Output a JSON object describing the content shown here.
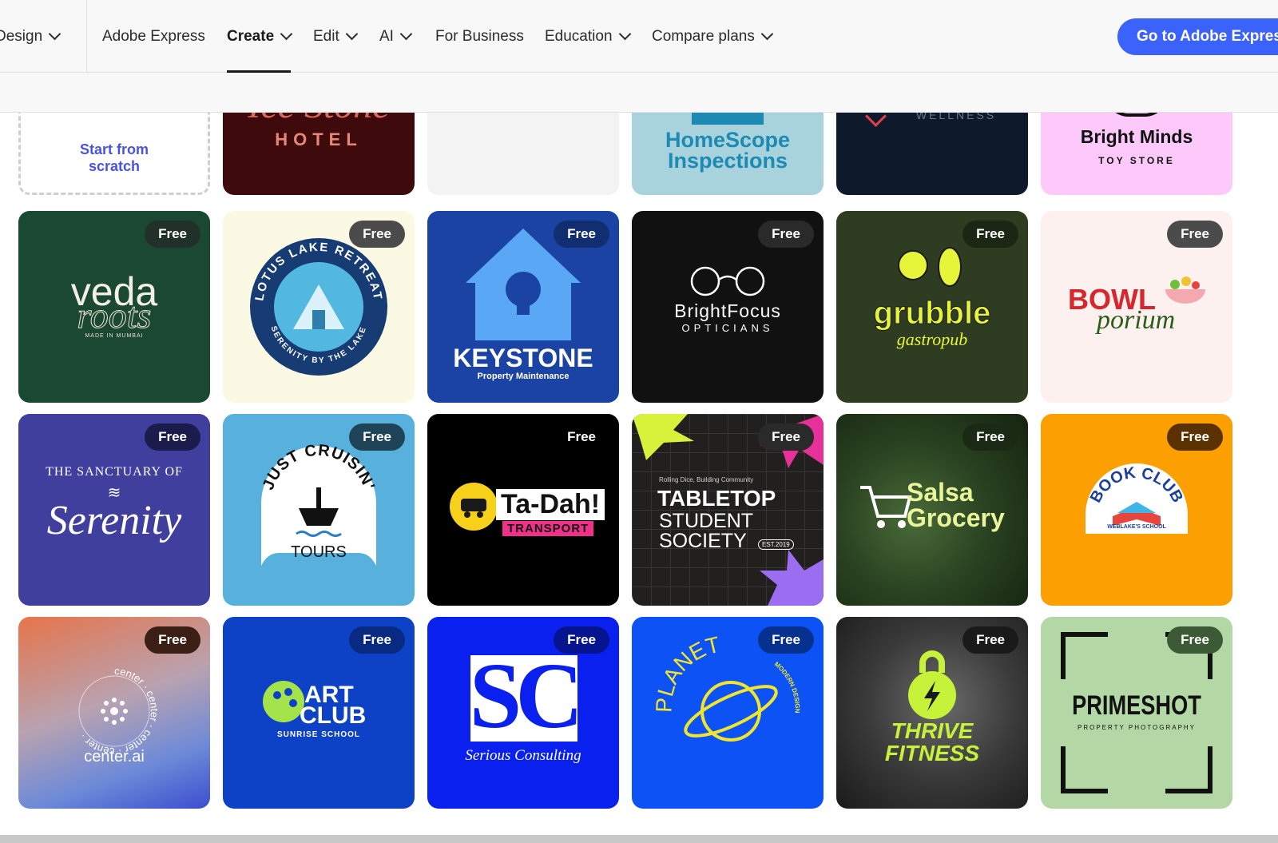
{
  "nav": {
    "items": [
      {
        "label": "Design"
      },
      {
        "label": "Adobe Express"
      },
      {
        "label": "Create"
      },
      {
        "label": "Edit"
      },
      {
        "label": "AI"
      },
      {
        "label": "For Business"
      },
      {
        "label": "Education"
      },
      {
        "label": "Compare plans"
      }
    ],
    "cta": "Go to Adobe Express"
  },
  "colors": {
    "accent": "#3b63fb",
    "scratch_text": "#4a52e0"
  },
  "badge_label": "Free",
  "row1": {
    "scratch": "Start from scratch",
    "hotel_partial": "Ice Stone",
    "hotel_sub": "HOTEL",
    "homescope_1": "HomeScope",
    "homescope_2": "Inspections",
    "wellness": "WELLNESS",
    "brightminds": "Bright Minds",
    "brightminds_sub": "TOY STORE"
  },
  "logos": {
    "veda": "veda",
    "veda_roots": "roots",
    "veda_sub": "MADE IN MUMBAI",
    "lotus_top": "LOTUS LAKE RETREAT",
    "lotus_bottom": "SERENITY BY THE LAKE",
    "keystone": "KEYSTONE",
    "keystone_sub": "Property Maintenance",
    "brightfocus": "BrightFocus",
    "brightfocus_sub": "OPTICIANS",
    "grubble": "grubble",
    "grubble_sub": "gastropub",
    "bowl": "BOWL",
    "bowl_sub": "porium",
    "serenity_top": "THE SANCTUARY OF",
    "serenity": "Serenity",
    "cruisin": "JUST CRUISIN'",
    "cruisin_sub": "TOURS",
    "tadah": "Ta-Dah!",
    "tadah_sub": "TRANSPORT",
    "tabletop_tag": "Rolling Dice, Building Community",
    "tabletop_1": "TABLETOP",
    "tabletop_2": "STUDENT",
    "tabletop_3": "SOCIETY",
    "tabletop_est": "EST.2019",
    "salsa_1": "Salsa",
    "salsa_2": "Grocery",
    "bookclub": "BOOK CLUB",
    "bookclub_sub": "WEBLAKE'S SCHOOL",
    "center_ring": "center · center · center · center ·",
    "center": "center.ai",
    "art_1": "ART",
    "art_2": "CLUB",
    "art_sub": "SUNRISE SCHOOL",
    "sc": "SC",
    "sc_sub": "Serious Consulting",
    "planet": "PLANET",
    "planet_sub": "MODERN DESIGN",
    "thrive_1": "THRIVE",
    "thrive_2": "FITNESS",
    "primeshot": "PRIMESHOT",
    "primeshot_sub": "PROPERTY PHOTOGRAPHY"
  }
}
